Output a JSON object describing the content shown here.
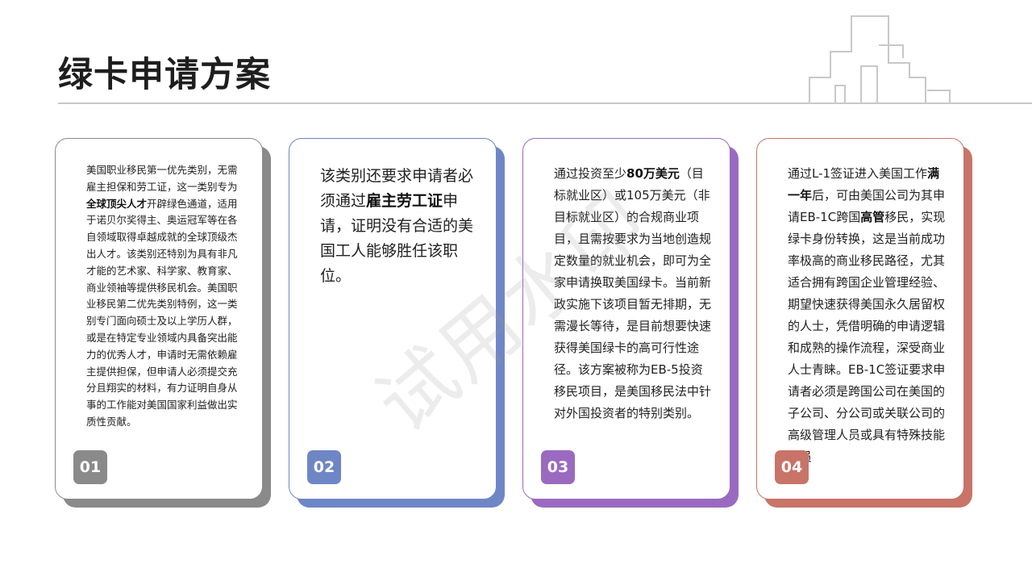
{
  "slide": {
    "title": "绿卡申请方案",
    "watermark": "试用水印"
  },
  "colors": {
    "card1": "#8a8a8a",
    "card2": "#6f86c6",
    "card3": "#9a6ac0",
    "card4": "#c87468"
  },
  "cards": [
    {
      "number": "01",
      "segments": [
        {
          "t": "美国职业移民第一优先类别，无需雇主担保和劳工证，这一类别专为"
        },
        {
          "t": "全球顶尖人才",
          "b": true
        },
        {
          "t": "开辟绿色通道，适用于诺贝尔奖得主、奥运冠军等在各自领域取得卓越成就的全球顶级杰出人才。该类别还特别为具有非凡才能的艺术家、科学家、教育家、商业领袖等提供移民机会。美国职业移民第二优先类别特例，这一类别专门面向硕士及以上学历人群，或是在特定专业领域内具备突出能力的优秀人才，申请时无需依赖雇主提供担保，但申请人必须提交充分且翔实的材料，有力证明自身从事的工作能对美国国家利益做出实质性贡献。"
        }
      ]
    },
    {
      "number": "02",
      "segments": [
        {
          "t": "该类别还要求申请者必须通过"
        },
        {
          "t": "雇主劳工证",
          "b": true
        },
        {
          "t": "申请，证明没有合适的美国工人能够胜任该职位。"
        }
      ]
    },
    {
      "number": "03",
      "segments": [
        {
          "t": "通过投资至少"
        },
        {
          "t": "80万美元",
          "b": true
        },
        {
          "t": "（目标就业区）或105万美元（非目标就业区）的合规商业项目，且需按要求为当地创造规定数量的就业机会，即可为全家申请换取美国绿卡。当前新政实施下该项目暂无排期，无需漫长等待，是目前想要快速获得美国绿卡的高可行性途径。该方案被称为EB-5投资移民项目，是美国移民法中针对外国投资者的特别类别。"
        }
      ]
    },
    {
      "number": "04",
      "segments": [
        {
          "t": "通过L-1签证进入美国工作"
        },
        {
          "t": "满一年",
          "b": true
        },
        {
          "t": "后，可由美国公司为其申请EB-1C跨国"
        },
        {
          "t": "高管",
          "b": true
        },
        {
          "t": "移民，实现绿卡身份转换，这是当前成功率极高的商业移民路径，尤其适合拥有跨国企业管理经验、期望快速获得美国永久居留权的人士，凭借明确的申请逻辑和成熟的操作流程，深受商业人士青睐。EB-1C签证要求申请者必须是跨国公司在美国的子公司、分公司或关联公司的高级管理人员或具有特殊技能的员"
        }
      ]
    }
  ]
}
